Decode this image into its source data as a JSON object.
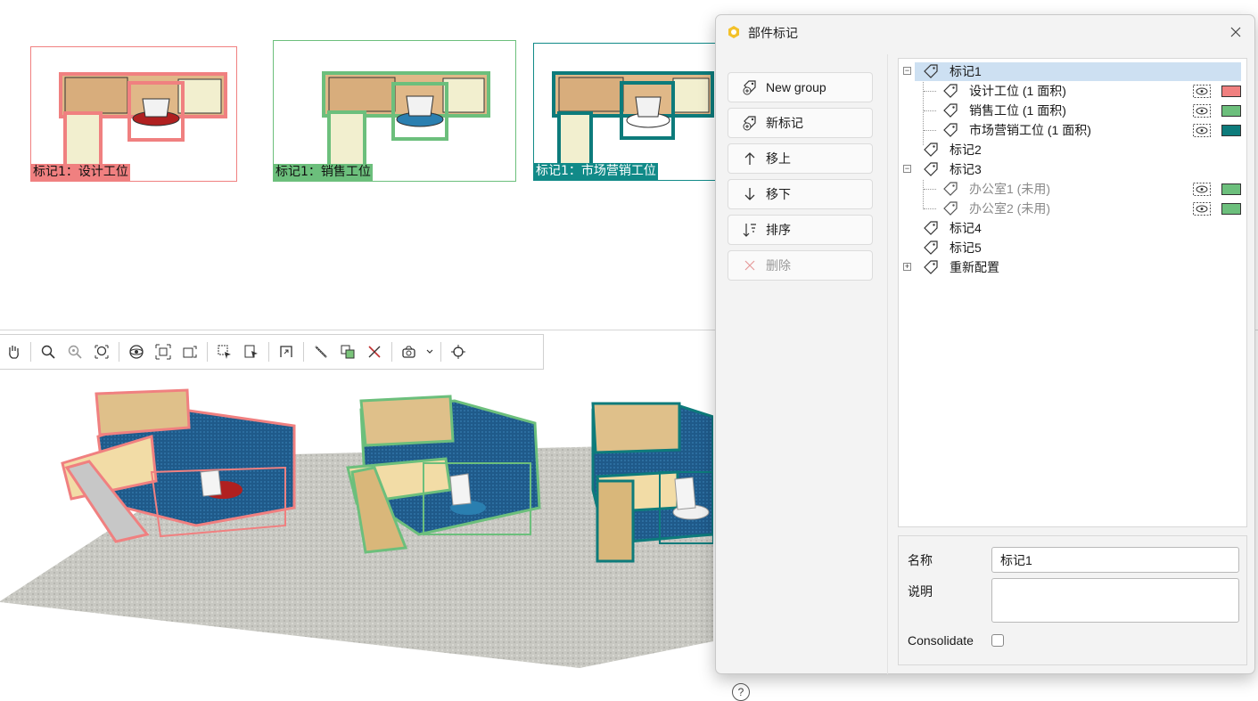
{
  "thumbnails": [
    {
      "label": "标记1：设计工位",
      "color": "#f08080",
      "label_bg": "#f08080",
      "chair": "#b02020"
    },
    {
      "label": "标记1：销售工位",
      "color": "#6cbf7c",
      "label_bg": "#6cbf7c",
      "chair": "#2a7fb0"
    },
    {
      "label": "标记1：市场营销工位",
      "color": "#0d7b7b",
      "label_bg": "#118a88",
      "chair": "#ffffff"
    }
  ],
  "toolbar": {
    "icons": [
      "pan-hand-icon",
      "zoom-icon",
      "zoom-out-icon",
      "zoom-fit-icon",
      "orbit-icon",
      "zoom-extents-icon",
      "zoom-selection-icon",
      "select-icon",
      "select-all-icon",
      "section-icon",
      "measure-icon",
      "mark-icon",
      "clear-mark-icon",
      "camera-icon",
      "chevron-down-icon",
      "focus-icon"
    ]
  },
  "dialog": {
    "title": "部件标记",
    "buttons": {
      "new_group": "New group",
      "new_mark": "新标记",
      "move_up": "移上",
      "move_down": "移下",
      "sort": "排序",
      "delete": "删除"
    },
    "help": "?",
    "tree": [
      {
        "label": "标记1",
        "level": 0,
        "expander": "⊟",
        "selected": true
      },
      {
        "label": "设计工位 (1 面积)",
        "level": 1,
        "color": "#f08080",
        "visible": true
      },
      {
        "label": "销售工位 (1 面积)",
        "level": 1,
        "color": "#6cbf7c",
        "visible": true
      },
      {
        "label": "市场营销工位 (1 面积)",
        "level": 1,
        "color": "#0d7b7b",
        "visible": true
      },
      {
        "label": "标记2",
        "level": 0
      },
      {
        "label": "标记3",
        "level": 0,
        "expander": "⊟"
      },
      {
        "label": "办公室1 (未用)",
        "level": 1,
        "color": "#6cbf7c",
        "visible": true,
        "muted": true
      },
      {
        "label": "办公室2 (未用)",
        "level": 1,
        "color": "#6cbf7c",
        "visible": true,
        "muted": true
      },
      {
        "label": "标记4",
        "level": 0
      },
      {
        "label": "标记5",
        "level": 0
      },
      {
        "label": "重新配置",
        "level": 0,
        "expander": "⊞"
      }
    ],
    "props": {
      "name_label": "名称",
      "name_value": "标记1",
      "desc_label": "说明",
      "desc_value": "",
      "consolidate_label": "Consolidate",
      "consolidate_checked": false
    }
  }
}
